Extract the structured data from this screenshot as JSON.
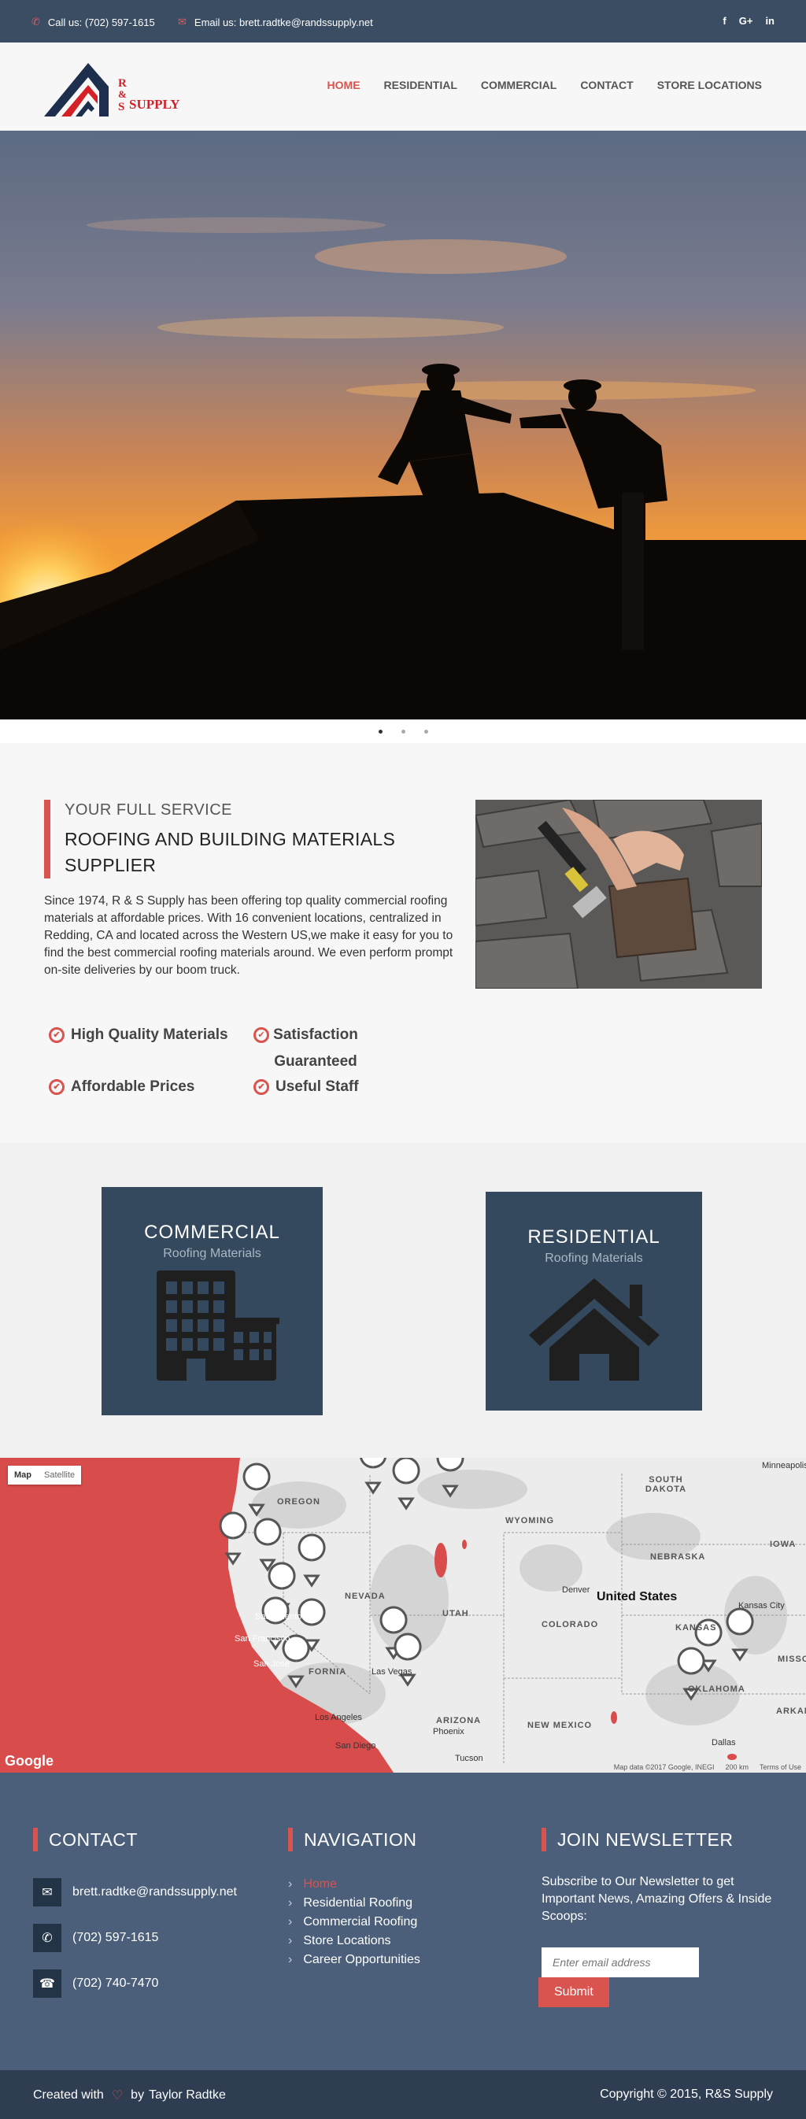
{
  "topbar": {
    "phone_text": "Call us: (702) 597-1615",
    "email_text": "Email us: brett.radtke@randssupply.net",
    "social": [
      "f",
      "G+",
      "in"
    ]
  },
  "logo": {
    "letters": "R & S",
    "word": "SUPPLY"
  },
  "nav": {
    "items": [
      "HOME",
      "RESIDENTIAL",
      "COMMERCIAL",
      "CONTACT",
      "STORE LOCATIONS"
    ],
    "active": "HOME"
  },
  "about": {
    "kicker": "YOUR FULL SERVICE",
    "title": "ROOFING AND BUILDING MATERIALS SUPPLIER",
    "body": "Since 1974, R & S Supply has been offering top quality commercial roofing materials at affordable prices. With 16 convenient locations, centralized in Redding, CA and located across the Western US,we make it easy for you to find the best commercial roofing materials around. We even perform prompt on-site deliveries by our boom truck.",
    "features": [
      "High Quality Materials",
      "Satisfaction Guaranteed",
      "Affordable Prices",
      "Useful Staff"
    ]
  },
  "categories": [
    {
      "title": "COMMERCIAL",
      "subtitle": "Roofing Materials",
      "icon": "building-icon"
    },
    {
      "title": "RESIDENTIAL",
      "subtitle": "Roofing Materials",
      "icon": "house-icon"
    }
  ],
  "map": {
    "type_buttons": [
      "Map",
      "Satellite"
    ],
    "states": [
      "OREGON",
      "WYOMING",
      "SOUTH DAKOTA",
      "NEBRASKA",
      "NEVADA",
      "UTAH",
      "COLORADO",
      "KANSAS",
      "ARIZONA",
      "NEW MEXICO",
      "OKLAHOMA",
      "IOWA",
      "MISSO",
      "ARKAN",
      "FORNIA"
    ],
    "cities": [
      "Minneapolis",
      "Denver",
      "Kansas City",
      "Sacramento",
      "San Francisco",
      "San Jose",
      "Las Vegas",
      "Los Angeles",
      "San Diego",
      "Phoenix",
      "Tucson",
      "Dallas"
    ],
    "country": "United States",
    "brand": "Google",
    "attribution": "Map data ©2017 Google, INEGI",
    "scale": "200 km",
    "terms": "Terms of Use"
  },
  "footer": {
    "contact": {
      "heading": "CONTACT",
      "email": "brett.radtke@randssupply.net",
      "phone": "(702) 597-1615",
      "fax": "(702) 740-7470"
    },
    "navigation": {
      "heading": "NAVIGATION",
      "items": [
        "Home",
        "Residential Roofing",
        "Commercial Roofing",
        "Store Locations",
        "Career Opportunities"
      ]
    },
    "newsletter": {
      "heading": "JOIN NEWSLETTER",
      "text": "Subscribe to Our Newsletter to get Important News, Amazing Offers & Inside Scoops:",
      "placeholder": "Enter email address",
      "button": "Submit"
    }
  },
  "bottom": {
    "created_prefix": "Created with",
    "created_by": "by",
    "author": "Taylor Radtke",
    "copyright": "Copyright © 2015, R&S Supply"
  },
  "colors": {
    "accent": "#d9534f",
    "navy": "#34495e",
    "topbar": "#3a4d63",
    "footer": "#4b5f7a"
  }
}
